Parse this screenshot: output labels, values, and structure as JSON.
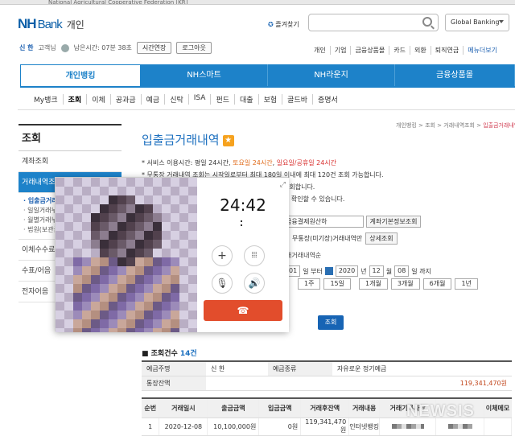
{
  "browser": {
    "strip_text": "National Agricultural Cooperative Federation [KR]"
  },
  "header": {
    "brand_nh": "NH",
    "brand_bank": "Bank",
    "brand_kind": "개인",
    "favorites": "즐겨찾기",
    "global": "Global Banking"
  },
  "user": {
    "name": "신 한",
    "suffix": "고객님",
    "time_left": "남은시간: 07분 38초",
    "extend": "시간연장",
    "logout": "로그아웃"
  },
  "util": [
    "개인",
    "기업",
    "금융상품몰",
    "카드",
    "외환",
    "퇴직연금",
    "메뉴더보기"
  ],
  "gnb": [
    "개인뱅킹",
    "NH스마트",
    "NH라운지",
    "금융상품몰"
  ],
  "subnav": [
    "My뱅크",
    "조회",
    "이체",
    "공과금",
    "예금",
    "신탁",
    "ISA",
    "펀드",
    "대출",
    "보험",
    "골드바",
    "증명서"
  ],
  "lnb": {
    "title": "조회",
    "items": [
      "계좌조회",
      "거래내역조회",
      "이체수수료",
      "수표/어음",
      "전자어음"
    ],
    "subs": [
      "· 입출금거래내",
      "· 일일거래누",
      "· 월별거래누",
      "· 법원(보관금"
    ]
  },
  "breadcrumb": {
    "prefix": "개인뱅킹 > 조회 > 거래내역조회 > ",
    "current": "입출금거래내역"
  },
  "page": {
    "title": "입출금거래내역",
    "star": "★"
  },
  "info": {
    "l1_a": "* 서비스 이용시간: 평일 24시간, ",
    "l1_b": "토요일 24시간",
    "l1_c": ", ",
    "l1_d": "일요일/공휴일 24시간",
    "l2": "* 무통장 거래내역 조회는 시작일로부터 최대 180일 이내에 최대 120건 조회 가능합니다.",
    "l3": "조회합니다.",
    "l4": "를 확인할 수 있습니다."
  },
  "form": {
    "account_select": "금융결제원산하",
    "acct_info_btn": "계좌기본정보조회",
    "radio_label": "무통장(미기장)거래내역만",
    "detail_btn": "상세조회",
    "desc_label": "래거래내역순",
    "date_from": [
      "01",
      "일 부터",
      "2020",
      "년",
      "12",
      "월",
      "08",
      "일 까지"
    ],
    "quick": [
      "1주",
      "15일",
      "1개월",
      "3개월",
      "6개월",
      "1년"
    ],
    "submit": "조회"
  },
  "summary": {
    "label": "조회건수",
    "count": "14건"
  },
  "account_table": {
    "owner_h": "예금주명",
    "owner": "신 한",
    "type_h": "예금종류",
    "type": "자유로운 정기예금",
    "bal_h": "통장잔액",
    "bal": "119,341,470원"
  },
  "tx_table": {
    "headers": [
      "순번",
      "거래일시",
      "출금금액",
      "입금금액",
      "거래후잔액",
      "거래내용",
      "거래기록사항",
      "",
      "이체메모"
    ],
    "rows": [
      [
        "1",
        "2020-12-08",
        "10,100,000원",
        "0원",
        "119,341,470원",
        "인터넷뱅킹",
        "",
        "",
        ""
      ]
    ]
  },
  "call": {
    "timer": "24:42"
  },
  "watermark": "NEWSIS",
  "colors": {
    "brand": "#1d82c9",
    "accent": "#e24d2c"
  }
}
